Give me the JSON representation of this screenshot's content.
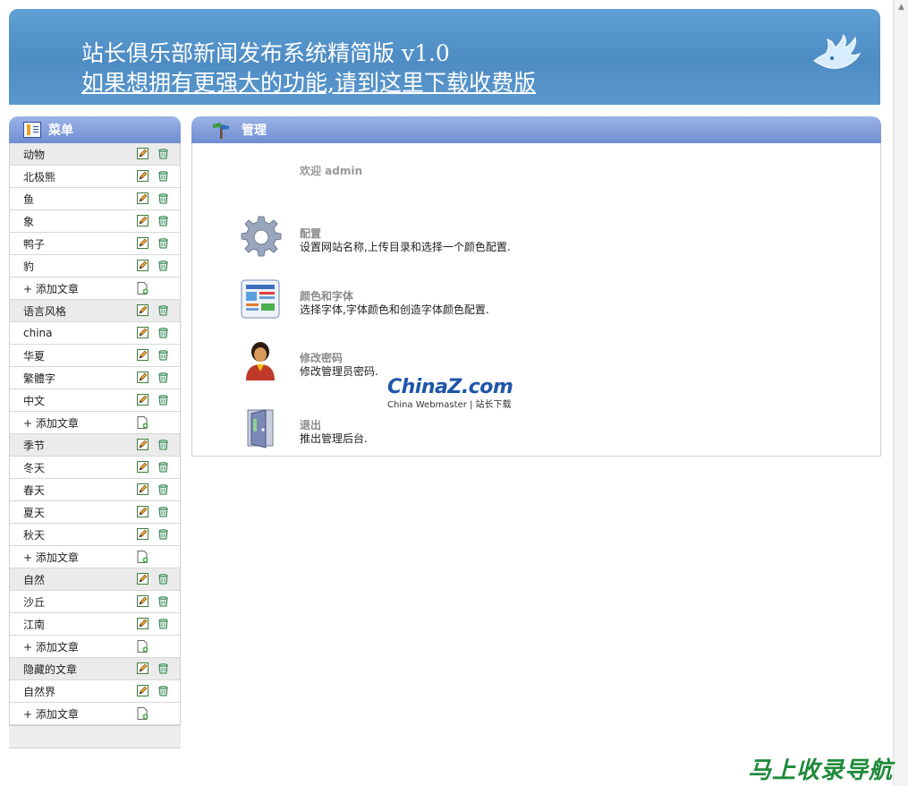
{
  "banner": {
    "title": "站长俱乐部新闻发布系统精简版  v1.0",
    "link_text": "如果想拥有更强大的功能,请到这里下载收费版"
  },
  "menu": {
    "title": "菜单",
    "rows": [
      {
        "type": "cat",
        "label": "动物"
      },
      {
        "type": "item",
        "label": "北极熊"
      },
      {
        "type": "item",
        "label": "鱼"
      },
      {
        "type": "item",
        "label": "象"
      },
      {
        "type": "item",
        "label": "鸭子"
      },
      {
        "type": "item",
        "label": "豹"
      },
      {
        "type": "add",
        "label": "+ 添加文章"
      },
      {
        "type": "cat",
        "label": "语言风格"
      },
      {
        "type": "item",
        "label": "china"
      },
      {
        "type": "item",
        "label": "华夏"
      },
      {
        "type": "item",
        "label": "繁體字"
      },
      {
        "type": "item",
        "label": "中文"
      },
      {
        "type": "add",
        "label": "+ 添加文章"
      },
      {
        "type": "cat",
        "label": "季节"
      },
      {
        "type": "item",
        "label": "冬天"
      },
      {
        "type": "item",
        "label": "春天"
      },
      {
        "type": "item",
        "label": "夏天"
      },
      {
        "type": "item",
        "label": "秋天"
      },
      {
        "type": "add",
        "label": "+ 添加文章"
      },
      {
        "type": "cat",
        "label": "自然"
      },
      {
        "type": "item",
        "label": "沙丘"
      },
      {
        "type": "item",
        "label": "江南"
      },
      {
        "type": "add",
        "label": "+ 添加文章"
      },
      {
        "type": "cat",
        "label": "隐藏的文章"
      },
      {
        "type": "item",
        "label": "自然界"
      },
      {
        "type": "add",
        "label": "+ 添加文章"
      }
    ]
  },
  "panel": {
    "title": "管理",
    "welcome": "欢迎 admin",
    "items": [
      {
        "icon": "gear-icon",
        "title": "配置",
        "desc": "设置网站名称,上传目录和选择一个颜色配置."
      },
      {
        "icon": "palette-layout-icon",
        "title": "颜色和字体",
        "desc": "选择字体,字体颜色和创造字体颜色配置."
      },
      {
        "icon": "user-icon",
        "title": "修改密码",
        "desc": "修改管理员密码."
      },
      {
        "icon": "exit-door-icon",
        "title": "退出",
        "desc": "推出管理后台."
      }
    ]
  },
  "watermark": {
    "brand_a": "China",
    "brand_z": "Z",
    "brand_b": ".com",
    "sub": "China Webmaster | 站长下载",
    "bottom": "马上收录导航"
  },
  "colors": {
    "banner_blue": "#4e8cc4",
    "header_blue": "#7d9bd8",
    "category_bg": "#ebebeb"
  }
}
